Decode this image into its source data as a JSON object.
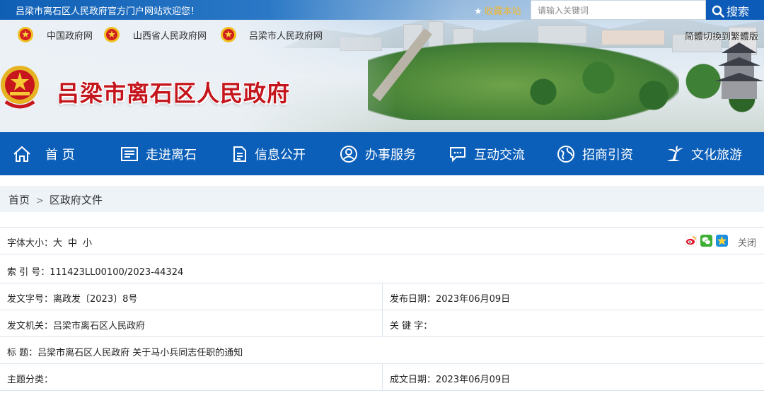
{
  "topbar": {
    "welcome": "吕梁市离石区人民政府官方门户网站欢迎您！",
    "favorite_label": "收藏本站",
    "search_placeholder": "请输入关键词",
    "search_button": "搜索"
  },
  "header": {
    "links": [
      "中国政府网",
      "山西省人民政府网",
      "吕梁市人民政府网"
    ],
    "language_toggle": "简體切換到繁體版",
    "site_title": "吕梁市离石区人民政府"
  },
  "nav": {
    "items": [
      {
        "label": "首 页",
        "icon": "home-icon"
      },
      {
        "label": "走进离石",
        "icon": "newspaper-icon"
      },
      {
        "label": "信息公开",
        "icon": "document-icon"
      },
      {
        "label": "办事服务",
        "icon": "user-circle-icon"
      },
      {
        "label": "互动交流",
        "icon": "chat-bubble-icon"
      },
      {
        "label": "招商引资",
        "icon": "globe-icon"
      },
      {
        "label": "文化旅游",
        "icon": "palm-tree-icon"
      }
    ]
  },
  "breadcrumb": {
    "home": "首页",
    "current": "区政府文件"
  },
  "info": {
    "font_size_label": "字体大小：",
    "font_sizes": [
      "大",
      "中",
      "小"
    ],
    "close_label": "关闭",
    "share_icons": [
      "weibo-icon",
      "wechat-icon",
      "qzone-icon"
    ],
    "index_label": "索  引  号：",
    "index_value": "111423LL00100/2023-44324",
    "doc_no_label": "发文字号：",
    "doc_no_value": "离政发〔2023〕8号",
    "publish_date_label": "发布日期：",
    "publish_date_value": "2023年06月09日",
    "issuer_label": "发文机关：",
    "issuer_value": "吕梁市离石区人民政府",
    "keywords_label": "关  键  字：",
    "keywords_value": "",
    "title_label": "标        题：",
    "title_value": "吕梁市离石区人民政府 关于马小兵同志任职的通知",
    "topic_label": "主题分类：",
    "topic_value": "",
    "created_date_label": "成文日期：",
    "created_date_value": "2023年06月09日"
  },
  "colors": {
    "nav_blue": "#0c5fb9",
    "title_red": "#c4151c",
    "favorite_gold": "#f2b62b"
  }
}
